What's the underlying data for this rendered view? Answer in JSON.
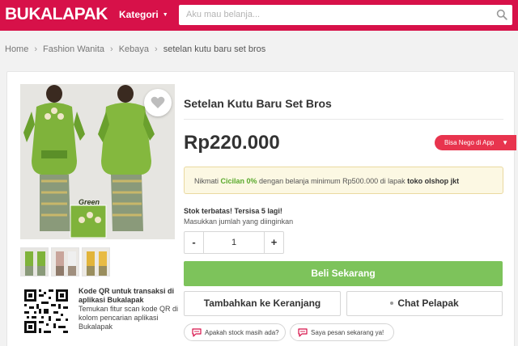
{
  "header": {
    "logo": "BUKALAPAK",
    "kategori": "Kategori",
    "search_placeholder": "Aku mau belanja..."
  },
  "breadcrumb": [
    "Home",
    "Fashion Wanita",
    "Kebaya",
    "setelan kutu baru set bros"
  ],
  "product": {
    "image_label": "Green",
    "title": "Setelan Kutu Baru Set Bros",
    "price": "Rp220.000",
    "nego_label": "Bisa Nego di App",
    "cicilan": {
      "prefix": "Nikmati ",
      "highlight": "Cicilan 0%",
      "middle": " dengan belanja minimum Rp500.000 di lapak ",
      "shop": "toko olshop jkt"
    },
    "stock_notice": "Stok terbatas! Tersisa 5 lagi!",
    "quantity_label": "Masukkan jumlah yang diinginkan",
    "quantity_minus": "-",
    "quantity_value": "1",
    "quantity_plus": "+",
    "buy_now": "Beli Sekarang",
    "add_to_cart": "Tambahkan ke Keranjang",
    "chat_seller": "Chat Pelapak",
    "quick_chats": [
      "Apakah stock masih ada?",
      "Saya pesan sekarang ya!"
    ]
  },
  "qr": {
    "title": "Kode QR untuk transaksi di aplikasi Bukalapak",
    "description": "Temukan fitur scan kode QR di kolom pencarian aplikasi Bukalapak"
  },
  "colors": {
    "brand": "#d71149",
    "buy_button": "#7dc35b",
    "nego_badge": "#e8344e",
    "cicilan_highlight": "#59a92c"
  },
  "icons": [
    "search-icon",
    "heart-icon",
    "chevron-down-icon",
    "chat-bubble-icon",
    "qr-code-icon"
  ]
}
